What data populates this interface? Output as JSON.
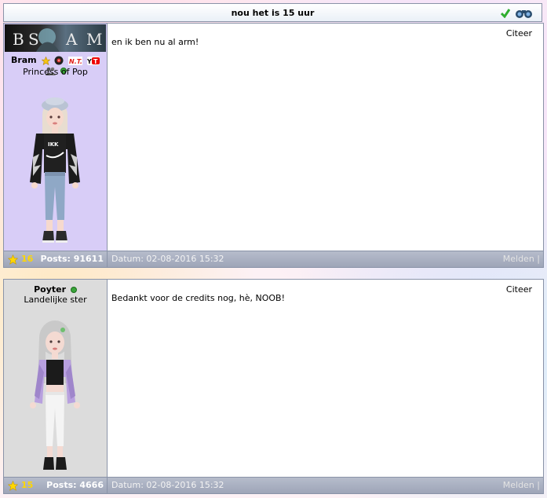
{
  "topic": {
    "title": "nou het is 15 uur"
  },
  "posts": [
    {
      "username": "Bram",
      "rank": "Princess of Pop",
      "banner_text": "B  A  M",
      "quote_label": "Citeer",
      "message": "en ik ben nu al arm!",
      "stars": "16",
      "posts_label": "Posts: 91611",
      "date": "Datum: 02-08-2016 15:32",
      "report_label": "Melden |",
      "sidebar_color": "#d8cdf7"
    },
    {
      "username": "Poyter",
      "rank": "Landelijke ster",
      "quote_label": "Citeer",
      "message": "Bedankt voor de credits nog, hè, NOOB!",
      "stars": "15",
      "posts_label": "Posts: 4666",
      "date": "Datum: 02-08-2016 15:32",
      "report_label": "Melden |",
      "sidebar_color": "#dcdcdc"
    }
  ],
  "icons": {
    "topic": [
      "check-icon",
      "binoculars-icon"
    ],
    "badges": [
      "star-badge-icon",
      "vinyl-badge-icon",
      "nt-badge-icon",
      "youtube-badge-icon",
      "friends-icon"
    ]
  }
}
